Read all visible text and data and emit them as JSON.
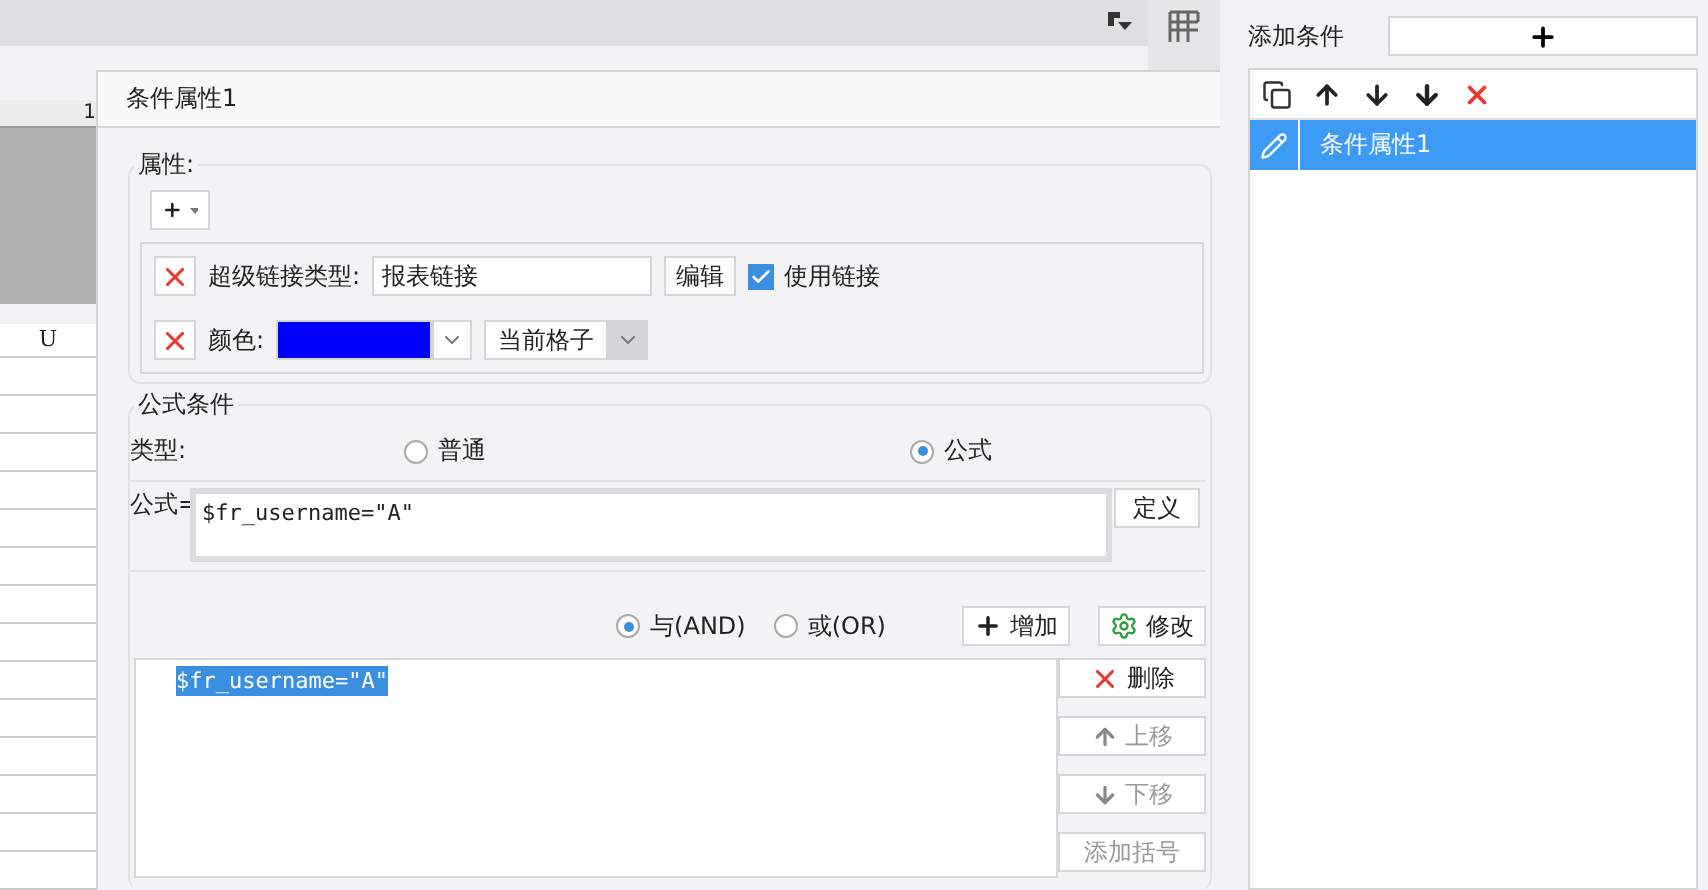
{
  "sheet": {
    "ruler_label": "1",
    "column_header": "U"
  },
  "dialog": {
    "title": "条件属性1",
    "attributes": {
      "legend": "属性:",
      "rows": [
        {
          "kind": "hyperlink",
          "label": "超级链接类型:",
          "value": "报表链接",
          "button": "编辑",
          "checkbox": {
            "label": "使用链接",
            "checked": true
          }
        },
        {
          "kind": "color",
          "label": "颜色:",
          "color": "#0000ff",
          "scope": "当前格子"
        }
      ]
    },
    "formula_condition": {
      "legend": "公式条件",
      "type_label": "类型:",
      "types": [
        {
          "label": "普通",
          "selected": false
        },
        {
          "label": "公式",
          "selected": true
        }
      ],
      "formula_label": "公式=",
      "formula": "$fr_username=\"A\"",
      "define_button": "定义",
      "logic": [
        {
          "label": "与(AND)",
          "selected": true
        },
        {
          "label": "或(OR)",
          "selected": false
        }
      ],
      "add_button": "增加",
      "modify_button": "修改",
      "conditions": [
        {
          "text": "$fr_username=\"A\"",
          "selected": true
        }
      ],
      "actions": [
        {
          "kind": "delete",
          "label": "删除",
          "disabled": false
        },
        {
          "kind": "up",
          "label": "上移",
          "disabled": true
        },
        {
          "kind": "down",
          "label": "下移",
          "disabled": true
        },
        {
          "kind": "bracket",
          "label": "添加括号",
          "disabled": true
        }
      ]
    }
  },
  "conditions_panel": {
    "label": "添加条件",
    "items": [
      {
        "label": "条件属性1",
        "selected": true
      }
    ]
  }
}
